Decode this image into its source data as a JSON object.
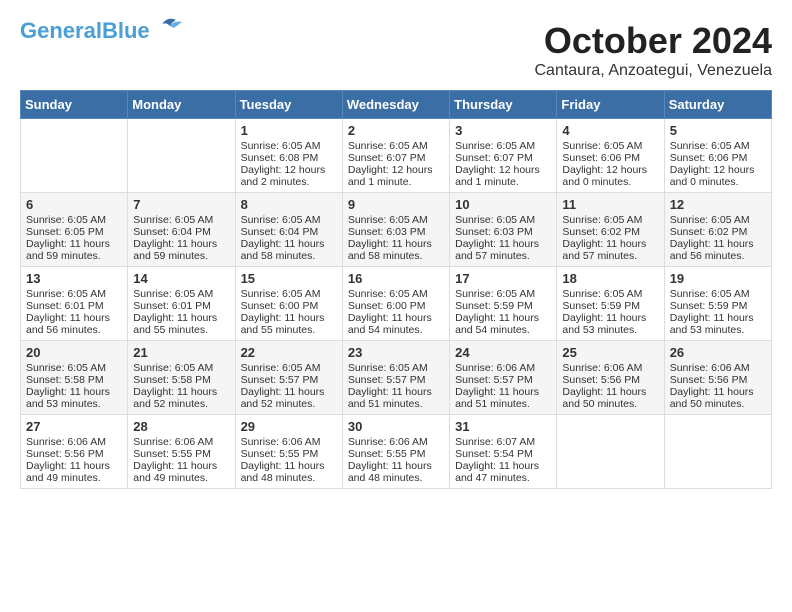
{
  "header": {
    "logo_line1": "General",
    "logo_line2": "Blue",
    "month": "October 2024",
    "location": "Cantaura, Anzoategui, Venezuela"
  },
  "weekdays": [
    "Sunday",
    "Monday",
    "Tuesday",
    "Wednesday",
    "Thursday",
    "Friday",
    "Saturday"
  ],
  "weeks": [
    [
      {
        "day": "",
        "content": ""
      },
      {
        "day": "",
        "content": ""
      },
      {
        "day": "1",
        "content": "Sunrise: 6:05 AM\nSunset: 6:08 PM\nDaylight: 12 hours\nand 2 minutes."
      },
      {
        "day": "2",
        "content": "Sunrise: 6:05 AM\nSunset: 6:07 PM\nDaylight: 12 hours\nand 1 minute."
      },
      {
        "day": "3",
        "content": "Sunrise: 6:05 AM\nSunset: 6:07 PM\nDaylight: 12 hours\nand 1 minute."
      },
      {
        "day": "4",
        "content": "Sunrise: 6:05 AM\nSunset: 6:06 PM\nDaylight: 12 hours\nand 0 minutes."
      },
      {
        "day": "5",
        "content": "Sunrise: 6:05 AM\nSunset: 6:06 PM\nDaylight: 12 hours\nand 0 minutes."
      }
    ],
    [
      {
        "day": "6",
        "content": "Sunrise: 6:05 AM\nSunset: 6:05 PM\nDaylight: 11 hours\nand 59 minutes."
      },
      {
        "day": "7",
        "content": "Sunrise: 6:05 AM\nSunset: 6:04 PM\nDaylight: 11 hours\nand 59 minutes."
      },
      {
        "day": "8",
        "content": "Sunrise: 6:05 AM\nSunset: 6:04 PM\nDaylight: 11 hours\nand 58 minutes."
      },
      {
        "day": "9",
        "content": "Sunrise: 6:05 AM\nSunset: 6:03 PM\nDaylight: 11 hours\nand 58 minutes."
      },
      {
        "day": "10",
        "content": "Sunrise: 6:05 AM\nSunset: 6:03 PM\nDaylight: 11 hours\nand 57 minutes."
      },
      {
        "day": "11",
        "content": "Sunrise: 6:05 AM\nSunset: 6:02 PM\nDaylight: 11 hours\nand 57 minutes."
      },
      {
        "day": "12",
        "content": "Sunrise: 6:05 AM\nSunset: 6:02 PM\nDaylight: 11 hours\nand 56 minutes."
      }
    ],
    [
      {
        "day": "13",
        "content": "Sunrise: 6:05 AM\nSunset: 6:01 PM\nDaylight: 11 hours\nand 56 minutes."
      },
      {
        "day": "14",
        "content": "Sunrise: 6:05 AM\nSunset: 6:01 PM\nDaylight: 11 hours\nand 55 minutes."
      },
      {
        "day": "15",
        "content": "Sunrise: 6:05 AM\nSunset: 6:00 PM\nDaylight: 11 hours\nand 55 minutes."
      },
      {
        "day": "16",
        "content": "Sunrise: 6:05 AM\nSunset: 6:00 PM\nDaylight: 11 hours\nand 54 minutes."
      },
      {
        "day": "17",
        "content": "Sunrise: 6:05 AM\nSunset: 5:59 PM\nDaylight: 11 hours\nand 54 minutes."
      },
      {
        "day": "18",
        "content": "Sunrise: 6:05 AM\nSunset: 5:59 PM\nDaylight: 11 hours\nand 53 minutes."
      },
      {
        "day": "19",
        "content": "Sunrise: 6:05 AM\nSunset: 5:59 PM\nDaylight: 11 hours\nand 53 minutes."
      }
    ],
    [
      {
        "day": "20",
        "content": "Sunrise: 6:05 AM\nSunset: 5:58 PM\nDaylight: 11 hours\nand 53 minutes."
      },
      {
        "day": "21",
        "content": "Sunrise: 6:05 AM\nSunset: 5:58 PM\nDaylight: 11 hours\nand 52 minutes."
      },
      {
        "day": "22",
        "content": "Sunrise: 6:05 AM\nSunset: 5:57 PM\nDaylight: 11 hours\nand 52 minutes."
      },
      {
        "day": "23",
        "content": "Sunrise: 6:05 AM\nSunset: 5:57 PM\nDaylight: 11 hours\nand 51 minutes."
      },
      {
        "day": "24",
        "content": "Sunrise: 6:06 AM\nSunset: 5:57 PM\nDaylight: 11 hours\nand 51 minutes."
      },
      {
        "day": "25",
        "content": "Sunrise: 6:06 AM\nSunset: 5:56 PM\nDaylight: 11 hours\nand 50 minutes."
      },
      {
        "day": "26",
        "content": "Sunrise: 6:06 AM\nSunset: 5:56 PM\nDaylight: 11 hours\nand 50 minutes."
      }
    ],
    [
      {
        "day": "27",
        "content": "Sunrise: 6:06 AM\nSunset: 5:56 PM\nDaylight: 11 hours\nand 49 minutes."
      },
      {
        "day": "28",
        "content": "Sunrise: 6:06 AM\nSunset: 5:55 PM\nDaylight: 11 hours\nand 49 minutes."
      },
      {
        "day": "29",
        "content": "Sunrise: 6:06 AM\nSunset: 5:55 PM\nDaylight: 11 hours\nand 48 minutes."
      },
      {
        "day": "30",
        "content": "Sunrise: 6:06 AM\nSunset: 5:55 PM\nDaylight: 11 hours\nand 48 minutes."
      },
      {
        "day": "31",
        "content": "Sunrise: 6:07 AM\nSunset: 5:54 PM\nDaylight: 11 hours\nand 47 minutes."
      },
      {
        "day": "",
        "content": ""
      },
      {
        "day": "",
        "content": ""
      }
    ]
  ]
}
